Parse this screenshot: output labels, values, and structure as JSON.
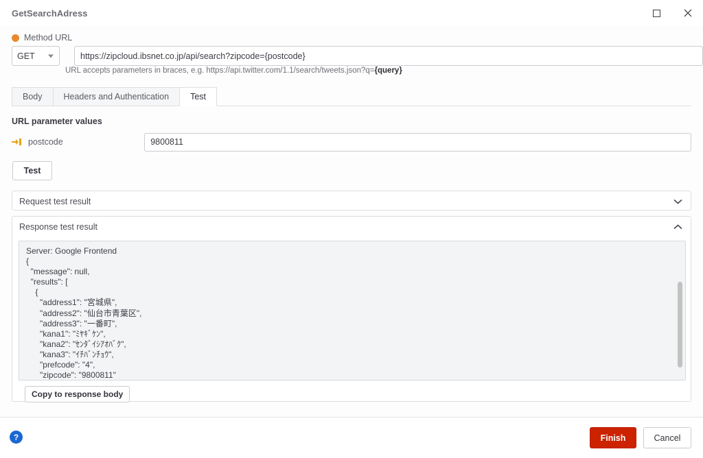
{
  "window": {
    "title": "GetSearchAdress",
    "controls": {
      "maximize": "maximize-icon",
      "close": "close-icon"
    }
  },
  "method_url": {
    "label": "Method URL",
    "bullet_color": "#e8892d",
    "method_selected": "GET",
    "url_value": "https://zipcloud.ibsnet.co.jp/api/search?zipcode={postcode}",
    "url_placeholder": "https://",
    "hint_prefix": "URL accepts parameters in braces, e.g. https://api.twitter.com/1.1/search/tweets.json?q=",
    "hint_highlight": "{query}"
  },
  "tabs": [
    {
      "label": "Body",
      "active": false
    },
    {
      "label": "Headers and Authentication",
      "active": false
    },
    {
      "label": "Test",
      "active": true
    }
  ],
  "test_panel": {
    "section_title": "URL parameter values",
    "parameter": {
      "icon": "parameter-arrow-icon",
      "name": "postcode",
      "value": "9800811",
      "placeholder": ""
    },
    "test_button_label": "Test",
    "request_accordion": {
      "title": "Request test result",
      "expanded": false,
      "chevron": "chevron-down-icon"
    },
    "response_accordion": {
      "title": "Response test result",
      "expanded": true,
      "chevron": "chevron-up-icon",
      "body_text": "Server: Google Frontend\n{\n  \"message\": null,\n  \"results\": [\n    {\n      \"address1\": \"宮城県\",\n      \"address2\": \"仙台市青葉区\",\n      \"address3\": \"一番町\",\n      \"kana1\": \"ﾐﾔｷﾞｹﾝ\",\n      \"kana2\": \"ｾﾝﾀﾞｲｼｱｵﾊﾞｸ\",\n      \"kana3\": \"ｲﾁﾊﾞﾝﾁｮｳ\",\n      \"prefcode\": \"4\",\n      \"zipcode\": \"9800811\"\n    }",
      "copy_button_label": "Copy to response body"
    }
  },
  "footer": {
    "help_icon_label": "?",
    "finish_label": "Finish",
    "cancel_label": "Cancel",
    "finish_color": "#cc2200"
  }
}
